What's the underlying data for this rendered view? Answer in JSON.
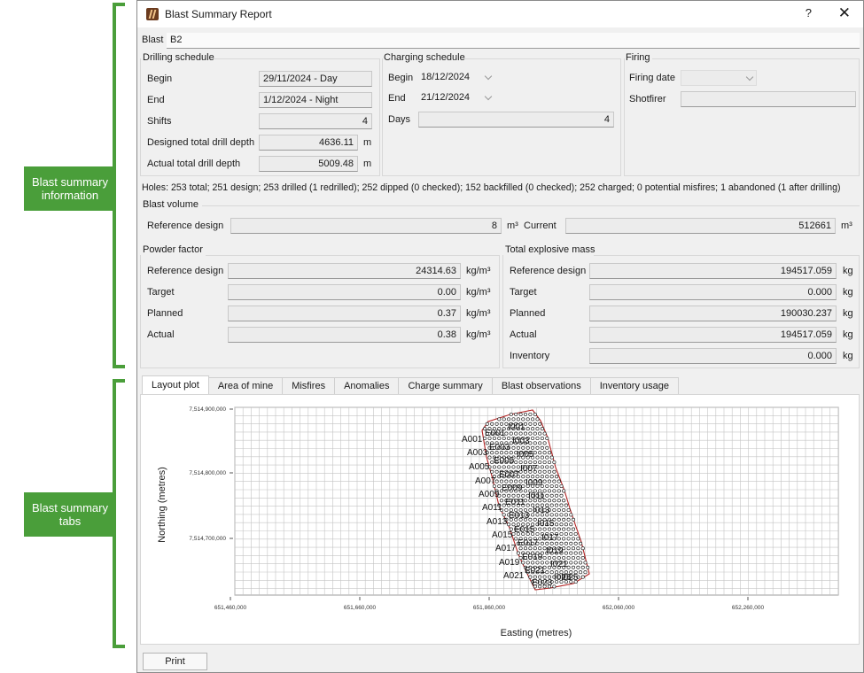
{
  "callouts": {
    "info": "Blast summary information",
    "tabs": "Blast summary tabs"
  },
  "window": {
    "title": "Blast Summary Report",
    "help": "?",
    "close": "✕",
    "icon": "blast-report-icon"
  },
  "blast": {
    "label": "Blast",
    "value": "B2"
  },
  "drilling": {
    "title": "Drilling schedule",
    "begin_label": "Begin",
    "begin": "29/11/2024 - Day",
    "end_label": "End",
    "end": "1/12/2024 - Night",
    "shifts_label": "Shifts",
    "shifts": "4",
    "designed_label": "Designed total drill depth",
    "designed": "4636.11",
    "designed_unit": "m",
    "actual_label": "Actual total drill depth",
    "actual": "5009.48",
    "actual_unit": "m"
  },
  "charging": {
    "title": "Charging schedule",
    "begin_label": "Begin",
    "begin": "18/12/2024",
    "end_label": "End",
    "end": "21/12/2024",
    "days_label": "Days",
    "days": "4"
  },
  "firing": {
    "title": "Firing",
    "date_label": "Firing date",
    "date": "",
    "shotfirer_label": "Shotfirer",
    "shotfirer": ""
  },
  "holes_summary": "Holes: 253 total; 251 design; 253 drilled (1 redrilled); 252 dipped (0 checked); 152 backfilled (0 checked); 252 charged; 0 potential misfires; 1 abandoned (1 after drilling)",
  "volume": {
    "title": "Blast volume",
    "ref_label": "Reference design",
    "ref": "8",
    "ref_unit": "m³",
    "current_label": "Current",
    "current": "512661",
    "current_unit": "m³"
  },
  "powder": {
    "title": "Powder factor",
    "rows": [
      {
        "label": "Reference design",
        "value": "24314.63",
        "unit": "kg/m³"
      },
      {
        "label": "Target",
        "value": "0.00",
        "unit": "kg/m³"
      },
      {
        "label": "Planned",
        "value": "0.37",
        "unit": "kg/m³"
      },
      {
        "label": "Actual",
        "value": "0.38",
        "unit": "kg/m³"
      }
    ]
  },
  "mass": {
    "title": "Total explosive mass",
    "rows": [
      {
        "label": "Reference design",
        "value": "194517.059",
        "unit": "kg"
      },
      {
        "label": "Target",
        "value": "0.000",
        "unit": "kg"
      },
      {
        "label": "Planned",
        "value": "190030.237",
        "unit": "kg"
      },
      {
        "label": "Actual",
        "value": "194517.059",
        "unit": "kg"
      },
      {
        "label": "Inventory",
        "value": "0.000",
        "unit": "kg"
      }
    ]
  },
  "tabs": [
    "Layout plot",
    "Area of mine",
    "Misfires",
    "Anomalies",
    "Charge summary",
    "Blast observations",
    "Inventory usage"
  ],
  "plot": {
    "ylabel": "Northing (metres)",
    "xlabel": "Easting (metres)",
    "yticks": [
      "7,514,900,000",
      "7,514,800,000",
      "7,514,700,000"
    ],
    "xticks": [
      "651,460,000",
      "651,660,000",
      "651,860,000",
      "652,060,000",
      "652,260,000"
    ],
    "hole_labels": [
      "A001",
      "A003",
      "A005",
      "A007",
      "A009",
      "A011",
      "A013",
      "A015",
      "A017",
      "A019",
      "A021",
      "E001",
      "E003",
      "E005",
      "E007",
      "E009",
      "E011",
      "E013",
      "E015",
      "E017",
      "E019",
      "E021",
      "E023",
      "I001",
      "I003",
      "I005",
      "I007",
      "I009",
      "I011",
      "I013",
      "I015",
      "I017",
      "I019",
      "I021",
      "I023",
      "I025"
    ],
    "outline_color": "#b22222"
  },
  "print_label": "Print"
}
